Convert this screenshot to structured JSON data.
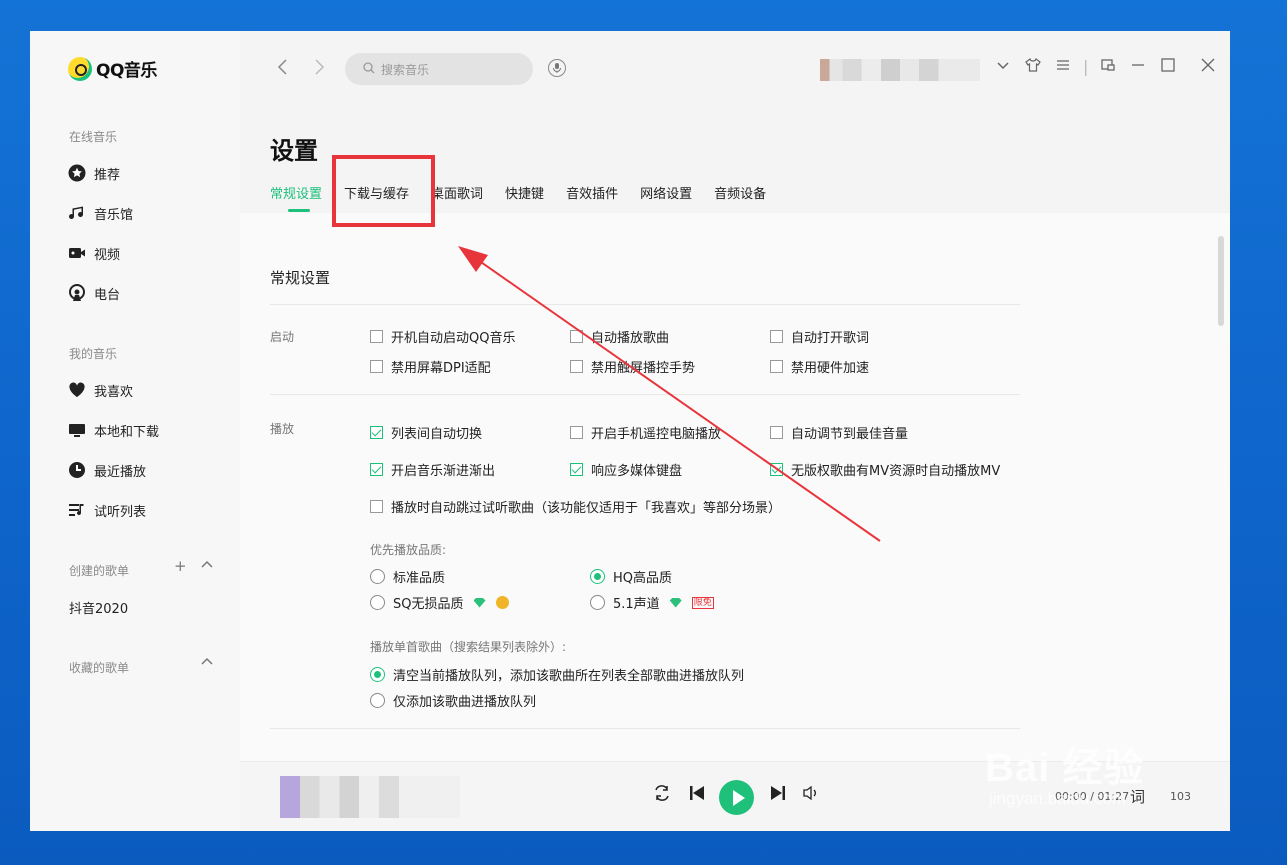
{
  "app": {
    "name": "QQ音乐"
  },
  "sidebar": {
    "sections": {
      "online": "在线音乐",
      "mine": "我的音乐",
      "created": "创建的歌单",
      "collected": "收藏的歌单"
    },
    "online_items": [
      {
        "label": "推荐",
        "icon": "star-icon"
      },
      {
        "label": "音乐馆",
        "icon": "music-note-icon"
      },
      {
        "label": "视频",
        "icon": "video-icon"
      },
      {
        "label": "电台",
        "icon": "radio-icon"
      }
    ],
    "my_items": [
      {
        "label": "我喜欢",
        "icon": "heart-icon"
      },
      {
        "label": "本地和下载",
        "icon": "computer-icon"
      },
      {
        "label": "最近播放",
        "icon": "clock-icon"
      },
      {
        "label": "试听列表",
        "icon": "playlist-icon"
      }
    ],
    "playlists": [
      "抖音2020"
    ]
  },
  "topbar": {
    "search_placeholder": "搜索音乐"
  },
  "settings": {
    "title": "设置",
    "tabs": [
      "常规设置",
      "下载与缓存",
      "桌面歌词",
      "快捷键",
      "音效插件",
      "网络设置",
      "音频设备"
    ],
    "active_tab": "常规设置",
    "section_title": "常规设置",
    "startup": {
      "label": "启动",
      "options": [
        {
          "label": "开机自动启动QQ音乐",
          "checked": false
        },
        {
          "label": "自动播放歌曲",
          "checked": false
        },
        {
          "label": "自动打开歌词",
          "checked": false
        },
        {
          "label": "禁用屏幕DPI适配",
          "checked": false
        },
        {
          "label": "禁用触屏播控手势",
          "checked": false
        },
        {
          "label": "禁用硬件加速",
          "checked": false
        }
      ]
    },
    "playback": {
      "label": "播放",
      "options": [
        {
          "label": "列表间自动切换",
          "checked": true
        },
        {
          "label": "开启手机遥控电脑播放",
          "checked": false
        },
        {
          "label": "自动调节到最佳音量",
          "checked": false
        },
        {
          "label": "开启音乐渐进渐出",
          "checked": true
        },
        {
          "label": "响应多媒体键盘",
          "checked": true
        },
        {
          "label": "无版权歌曲有MV资源时自动播放MV",
          "checked": true
        },
        {
          "label": "播放时自动跳过试听歌曲（该功能仅适用于「我喜欢」等部分场景）",
          "checked": false
        }
      ],
      "quality_label": "优先播放品质:",
      "quality_options": [
        {
          "label": "标准品质",
          "selected": false
        },
        {
          "label": "HQ高品质",
          "selected": true
        },
        {
          "label": "SQ无损品质",
          "selected": false
        },
        {
          "label": "5.1声道",
          "selected": false,
          "badge": "限免"
        }
      ],
      "single_label": "播放单首歌曲（搜索结果列表除外）:",
      "single_options": [
        {
          "label": "清空当前播放队列，添加该歌曲所在列表全部歌曲进播放队列",
          "selected": true
        },
        {
          "label": "仅添加该歌曲进播放队列",
          "selected": false
        }
      ]
    }
  },
  "player": {
    "time": "00:00 / 01:27",
    "lyric_label": "词",
    "volume": "103"
  },
  "watermark": {
    "main": "Bai 经验",
    "sub": "jingyan.baidu.com"
  },
  "colors": {
    "accent": "#1ec07a",
    "highlight": "#e8343b",
    "desktop": "#0f66cc"
  }
}
